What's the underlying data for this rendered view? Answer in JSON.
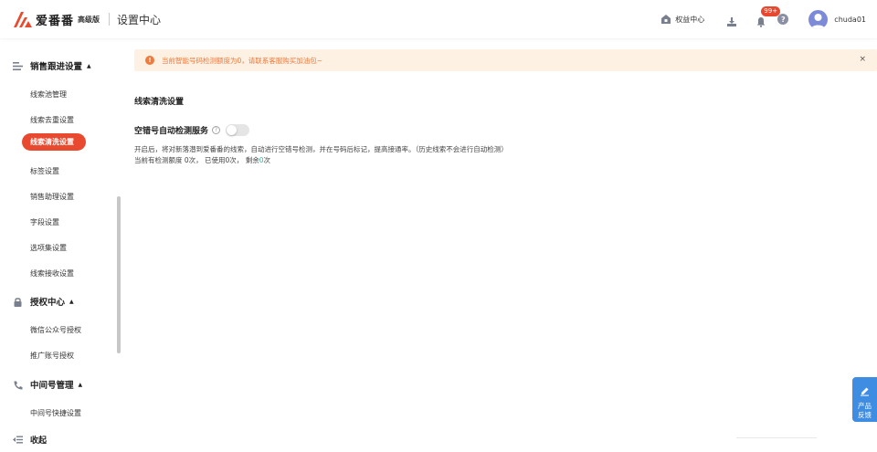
{
  "header": {
    "brand_name": "爱番番",
    "brand_tier": "高级版",
    "page_title": "设置中心",
    "rights_label": "权益中心",
    "notification_count": "99+",
    "help_glyph": "?",
    "username": "chuda01"
  },
  "sidebar": {
    "groups": [
      {
        "label": "销售跟进设置",
        "icon": "list-icon",
        "items": [
          "线索池管理",
          "线索去重设置",
          "线索清洗设置",
          "标签设置",
          "销售助理设置",
          "字段设置",
          "选项集设置",
          "线索接收设置"
        ],
        "active": "线索清洗设置"
      },
      {
        "label": "授权中心",
        "icon": "lock-icon",
        "items": [
          "微信公众号授权",
          "推广账号授权"
        ]
      },
      {
        "label": "中间号管理",
        "icon": "phone-icon",
        "items": [
          "中间号快捷设置"
        ]
      }
    ],
    "caret": "▲",
    "collapse_label": "收起"
  },
  "main": {
    "alert": {
      "text": "当前智能号码检测额度为0，请联系客服购买加油包~",
      "icon_glyph": "!",
      "close_glyph": "×"
    },
    "section_title": "线索清洗设置",
    "service": {
      "label": "空错号自动检测服务",
      "help_glyph": "?",
      "enabled": false,
      "description": "开启后，将对新落潜到爱番番的线索，自动进行空错号检测，并在号码后标记，提高接通率。（历史线索不会进行自动检测）",
      "quota_prefix": "当前有检测额度 0次， 已使用0次， 剩余",
      "quota_remaining": "0",
      "quota_suffix": "次"
    }
  },
  "feedback": {
    "label": "产品反馈"
  },
  "colors": {
    "accent": "#e94a2f",
    "alert_text": "#ef7a3c",
    "alert_bg": "#fdf1e4",
    "feedback_bg": "#3f8de3",
    "avatar_bg": "#7d8ad8",
    "remaining_highlight": "#2fb8a3"
  }
}
